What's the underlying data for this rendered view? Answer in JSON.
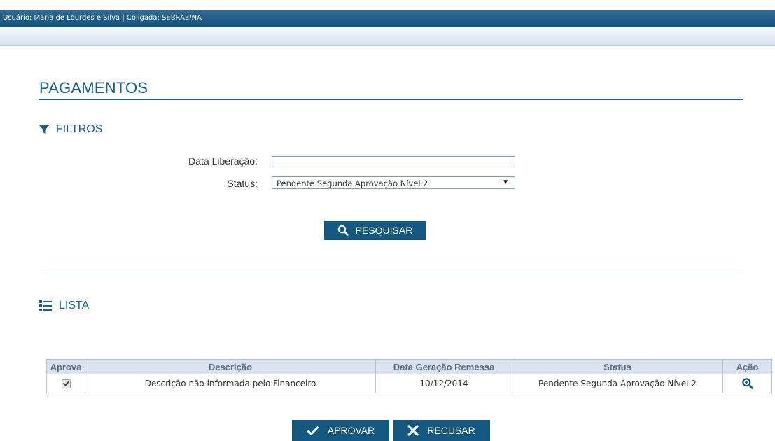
{
  "header": {
    "user_info": "Usuário: Maria de Lourdes e Silva | Coligada: SEBRAE/NA"
  },
  "page": {
    "title": "PAGAMENTOS"
  },
  "filters": {
    "title": "FILTROS",
    "date_label": "Data Liberação:",
    "date_value": "",
    "status_label": "Status:",
    "status_selected": "Pendente Segunda Aprovação Nível 2",
    "search_button": "PESQUISAR"
  },
  "list": {
    "title": "LISTA",
    "columns": [
      "Aprova",
      "Descrição",
      "Data Geração Remessa",
      "Status",
      "Ação"
    ],
    "rows": [
      {
        "approved": true,
        "description": "Descrição não informada pelo Financeiro",
        "date": "10/12/2014",
        "status": "Pendente Segunda Aprovação Nível 2",
        "action_icon": "zoom-in-icon"
      }
    ]
  },
  "actions": {
    "approve": "APROVAR",
    "reject": "RECUSAR"
  },
  "colors": {
    "brand": "#1b5f8a",
    "button": "#14587f",
    "header_bar": "#1d5a85"
  }
}
